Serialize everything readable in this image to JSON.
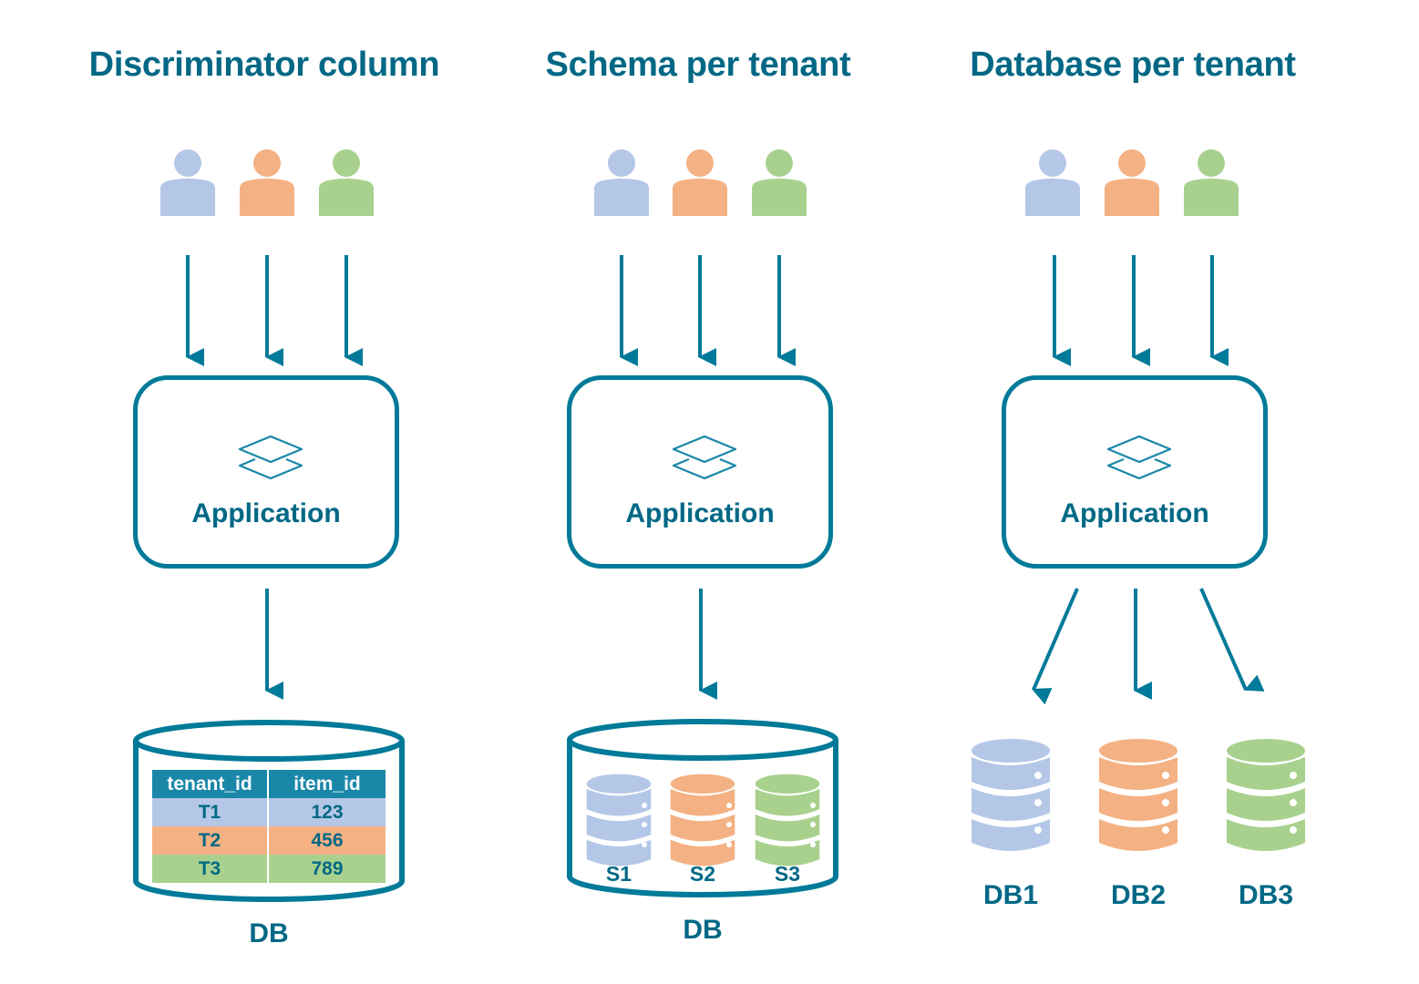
{
  "colors": {
    "primary": "#006885",
    "stroke": "#007a99",
    "header_bg": "#1a87a8",
    "tenant_blue": "#b4c7e7",
    "tenant_orange": "#f4b183",
    "tenant_green": "#a9d18e"
  },
  "panels": [
    {
      "title": "Discriminator column",
      "app_label": "Application",
      "db_label": "DB",
      "table": {
        "headers": [
          "tenant_id",
          "item_id"
        ],
        "rows": [
          [
            "T1",
            "123"
          ],
          [
            "T2",
            "456"
          ],
          [
            "T3",
            "789"
          ]
        ]
      }
    },
    {
      "title": "Schema per tenant",
      "app_label": "Application",
      "db_label": "DB",
      "schemas": [
        "S1",
        "S2",
        "S3"
      ]
    },
    {
      "title": "Database per tenant",
      "app_label": "Application",
      "databases": [
        "DB1",
        "DB2",
        "DB3"
      ]
    }
  ],
  "icons": {
    "user": "user-icon",
    "app": "layers-icon",
    "db": "database-icon",
    "arrow": "arrow-down-icon"
  }
}
